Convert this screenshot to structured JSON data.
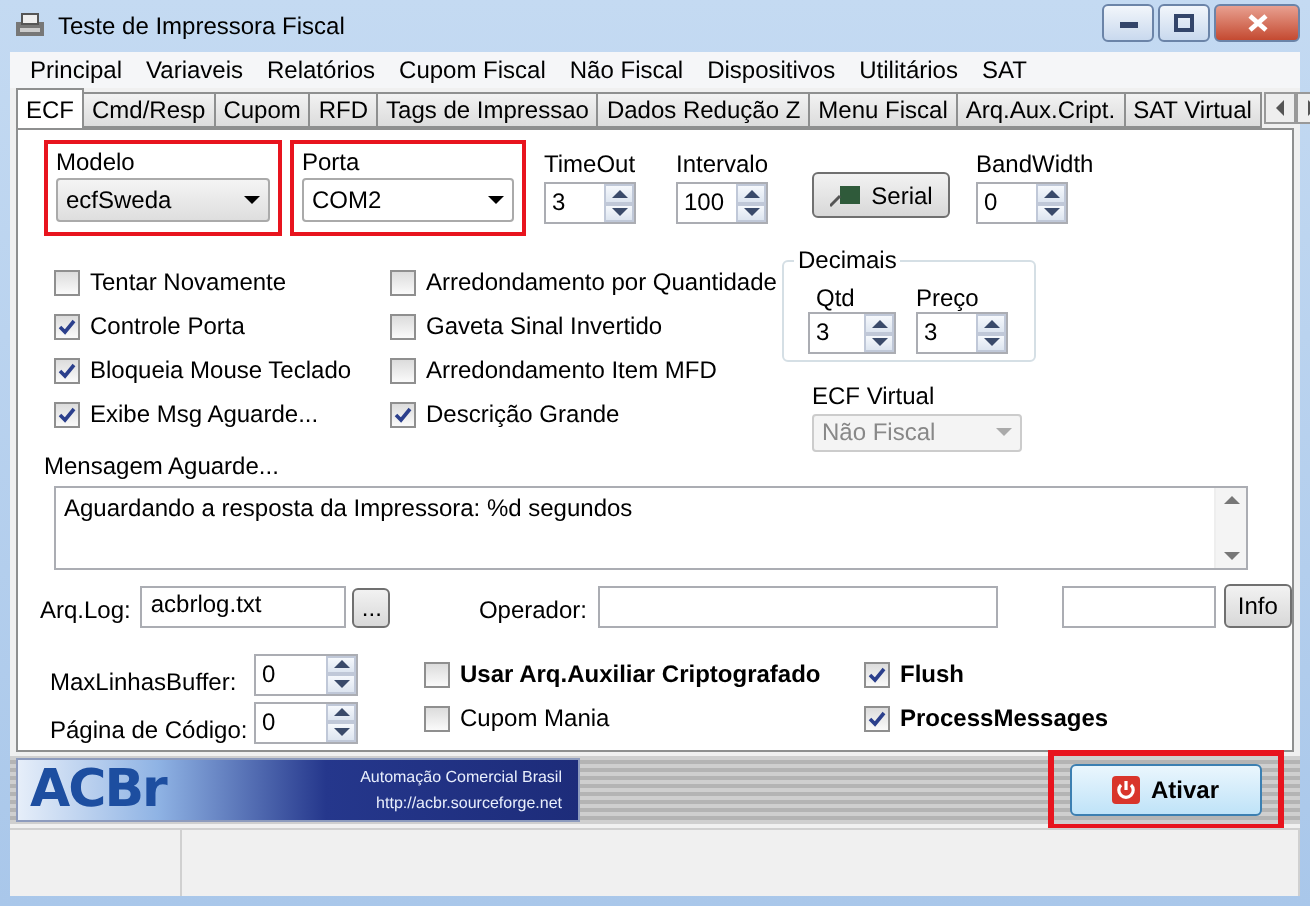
{
  "window": {
    "title": "Teste de Impressora Fiscal"
  },
  "menu": [
    "Principal",
    "Variaveis",
    "Relatórios",
    "Cupom Fiscal",
    "Não Fiscal",
    "Dispositivos",
    "Utilitários",
    "SAT"
  ],
  "tabs": [
    {
      "label": "ECF",
      "selected": true
    },
    {
      "label": "Cmd/Resp",
      "selected": false
    },
    {
      "label": "Cupom",
      "selected": false
    },
    {
      "label": "RFD",
      "selected": false
    },
    {
      "label": "Tags de Impressao",
      "selected": false
    },
    {
      "label": "Dados Redução Z",
      "selected": false
    },
    {
      "label": "Menu Fiscal",
      "selected": false
    },
    {
      "label": "Arq.Aux.Cript.",
      "selected": false
    },
    {
      "label": "SAT Virtual",
      "selected": false
    }
  ],
  "modelo": {
    "label": "Modelo",
    "value": "ecfSweda",
    "highlighted": true
  },
  "porta": {
    "label": "Porta",
    "value": "COM2",
    "highlighted": true
  },
  "spinners": [
    {
      "label": "TimeOut",
      "value": "3"
    },
    {
      "label": "Intervalo",
      "value": "100"
    }
  ],
  "serial_button": "Serial",
  "bandwidth": {
    "label": "BandWidth",
    "value": "0"
  },
  "options_left": [
    {
      "label": "Tentar Novamente",
      "checked": false
    },
    {
      "label": "Controle Porta",
      "checked": true
    },
    {
      "label": "Bloqueia Mouse Teclado",
      "checked": true
    },
    {
      "label": "Exibe Msg Aguarde...",
      "checked": true
    }
  ],
  "options_right": [
    {
      "label": "Arredondamento por Quantidade",
      "checked": false
    },
    {
      "label": "Gaveta Sinal Invertido",
      "checked": false
    },
    {
      "label": "Arredondamento Item MFD",
      "checked": false
    },
    {
      "label": "Descrição Grande",
      "checked": true
    }
  ],
  "decimais": {
    "title": "Decimais",
    "fields": [
      {
        "label": "Qtd",
        "value": "3"
      },
      {
        "label": "Preço",
        "value": "3"
      }
    ]
  },
  "ecf_virtual": {
    "label": "ECF Virtual",
    "value": "Não Fiscal",
    "disabled": true
  },
  "mensagem": {
    "label": "Mensagem Aguarde...",
    "value": "Aguardando a resposta da Impressora: %d segundos"
  },
  "arq_log": {
    "label": "Arq.Log:",
    "value": "acbrlog.txt",
    "browse": "..."
  },
  "operador": {
    "label": "Operador:"
  },
  "info_button": "Info",
  "buffers": [
    {
      "label": "MaxLinhasBuffer:",
      "value": "0"
    },
    {
      "label": "Página de Código:",
      "value": "0"
    }
  ],
  "flags_left": [
    {
      "label": "Usar Arq.Auxiliar Criptografado",
      "checked": false,
      "bold": true
    },
    {
      "label": "Cupom Mania",
      "checked": false,
      "bold": false
    }
  ],
  "flags_right": [
    {
      "label": "Flush",
      "checked": true,
      "bold": true
    },
    {
      "label": "ProcessMessages",
      "checked": true,
      "bold": true
    }
  ],
  "banner": {
    "logo": "ACBr",
    "tagline": "Automação Comercial Brasil",
    "url": "http://acbr.sourceforge.net"
  },
  "activate_button": {
    "label": "Ativar",
    "highlighted": true
  }
}
